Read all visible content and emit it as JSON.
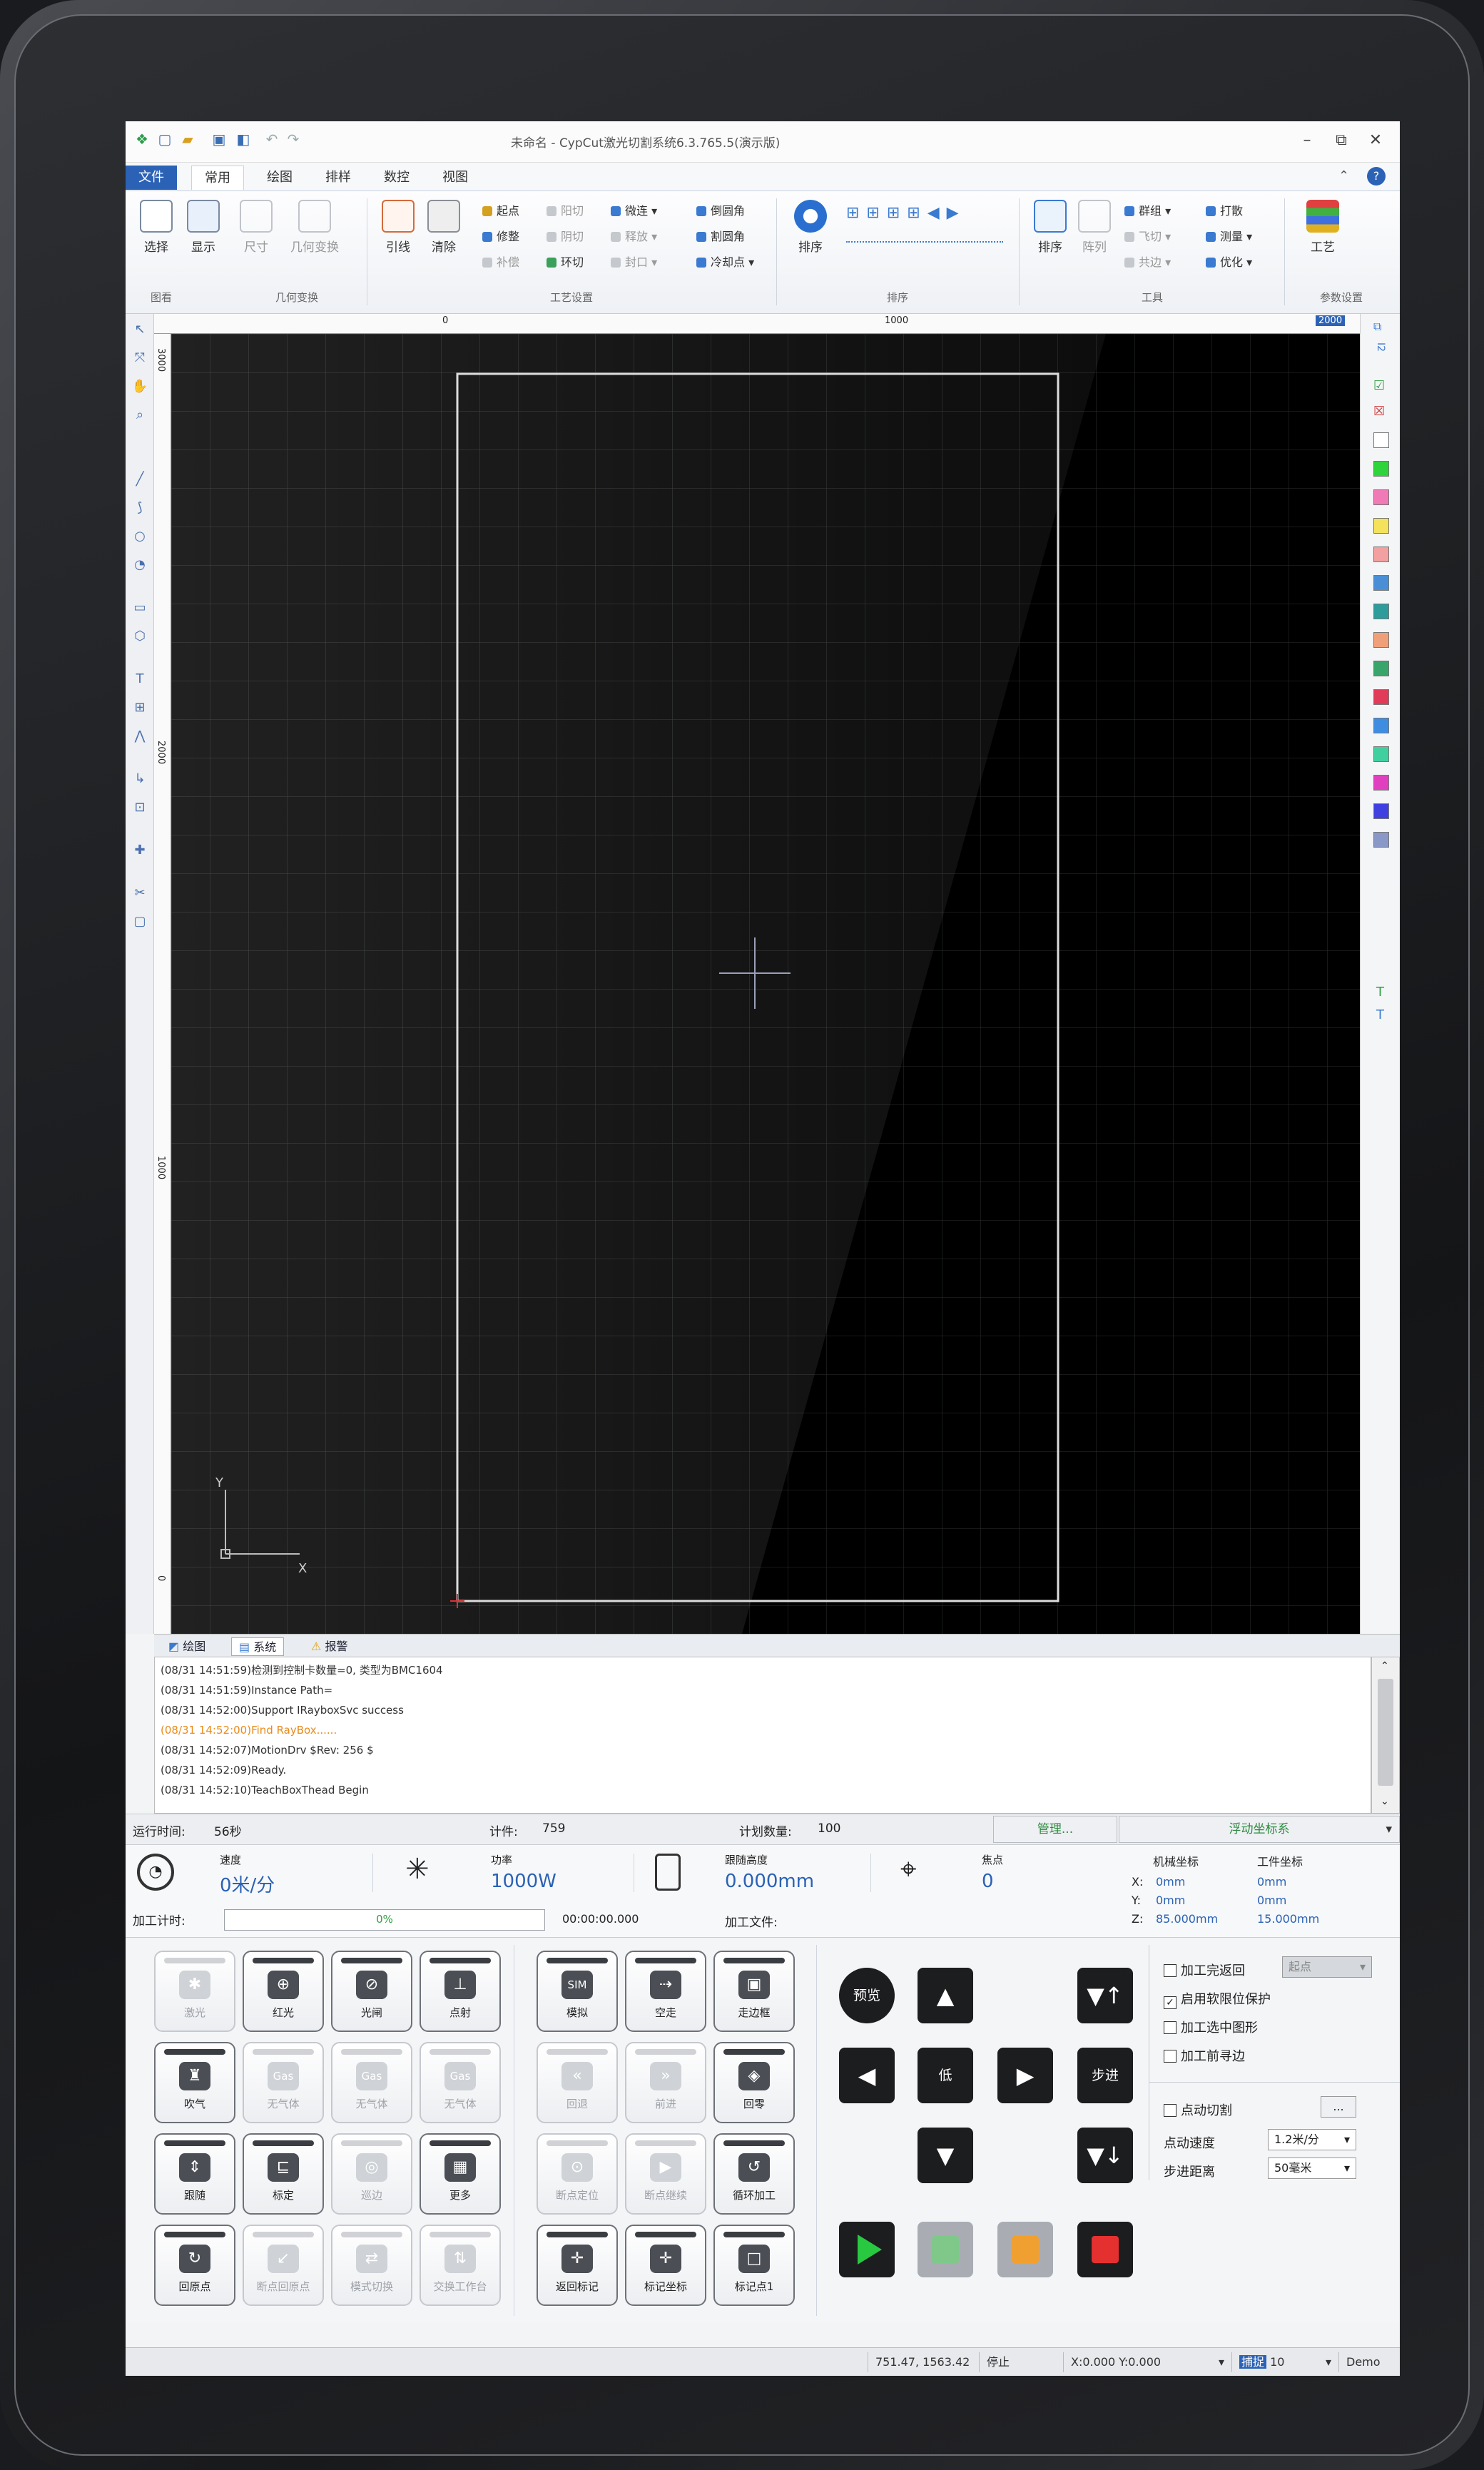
{
  "window": {
    "title": "未命名 - CypCut激光切割系统6.3.765.5(演示版)",
    "quick_access": [
      "logo-icon",
      "new-icon",
      "open-icon",
      "save-icon",
      "settings-icon",
      "undo-icon",
      "redo-icon"
    ],
    "controls": [
      "minimize-icon",
      "restore-icon",
      "close-icon"
    ]
  },
  "menu": {
    "tabs": [
      "文件",
      "常用",
      "绘图",
      "排样",
      "数控",
      "视图"
    ],
    "active": "常用",
    "right_icons": [
      "chevron-up-icon",
      "help-icon"
    ]
  },
  "ribbon": {
    "select": "选择",
    "display": "显示",
    "size": "尺寸",
    "geometry": "几何变换",
    "lead": "引线",
    "clear": "清除",
    "small_col1": [
      "起点",
      "修整",
      "补偿"
    ],
    "small_col2": [
      "阳切",
      "阴切",
      "环切"
    ],
    "small_col3": [
      "微连",
      "释放",
      "封口"
    ],
    "small_col4": [
      "倒圆角",
      "割圆角",
      "冷却点"
    ],
    "sort": "排序",
    "sort_buttons": [
      "排序",
      "阵列"
    ],
    "tools_col": [
      "群组",
      "飞切",
      "共边"
    ],
    "tools_col2": [
      "打散",
      "测量",
      "优化"
    ],
    "process": "工艺",
    "groups": {
      "view": "图看",
      "geometry": "几何变换",
      "process_set": "工艺设置",
      "sort": "排序",
      "tools": "工具",
      "params": "参数设置"
    }
  },
  "ruler": {
    "top": [
      "0",
      "1000",
      "2000"
    ],
    "left": [
      "3000",
      "2000",
      "1000",
      "0"
    ]
  },
  "canvas": {
    "axis_y": "Y",
    "axis_x": "X"
  },
  "palette_colors": [
    "#ffffff",
    "#2fd33b",
    "#f07ab6",
    "#f4e25c",
    "#f2a0a0",
    "#4a8fd6",
    "#2f9c9c",
    "#f0a078",
    "#3aa56a",
    "#e03c5a",
    "#3f8de0",
    "#40d0a0",
    "#e040c0",
    "#4040e0",
    "#8a98c8"
  ],
  "log": {
    "tabs": [
      "绘图",
      "系统",
      "报警"
    ],
    "lines": [
      {
        "text": "(08/31 14:51:59)检测到控制卡数量=0, 类型为BMC1604",
        "color": "#333333"
      },
      {
        "text": "(08/31 14:51:59)Instance Path=",
        "color": "#333333"
      },
      {
        "text": "(08/31 14:52:00)Support IRayboxSvc success",
        "color": "#333333"
      },
      {
        "text": "(08/31 14:52:00)Find RayBox......",
        "color": "#e88a1a"
      },
      {
        "text": "(08/31 14:52:07)MotionDrv $Rev: 256 $",
        "color": "#333333"
      },
      {
        "text": "(08/31 14:52:09)Ready.",
        "color": "#333333"
      },
      {
        "text": "(08/31 14:52:10)TeachBoxThead Begin",
        "color": "#333333"
      }
    ]
  },
  "info": {
    "run_time_label": "运行时间:",
    "run_time": "56秒",
    "count_label": "计件:",
    "count": "759",
    "plan_label": "计划数量:",
    "plan": "100",
    "manage": "管理...",
    "float_coord": "浮动坐标系",
    "speed_label": "速度",
    "speed": "0米/分",
    "power_label": "功率",
    "power": "1000W",
    "follow_label": "跟随高度",
    "follow": "0.000mm",
    "focus_label": "焦点",
    "focus": "0",
    "machine_coord": "机械坐标",
    "work_coord": "工件坐标",
    "coords": [
      {
        "axis": "X:",
        "machine": "0mm",
        "work": "0mm"
      },
      {
        "axis": "Y:",
        "machine": "0mm",
        "work": "0mm"
      },
      {
        "axis": "Z:",
        "machine": "85.000mm",
        "work": "15.000mm"
      }
    ],
    "timer_label": "加工计时:",
    "progress_text": "0%",
    "progress": 0,
    "elapsed": "00:00:00.000",
    "file_label": "加工文件:"
  },
  "panel": {
    "left": [
      [
        {
          "label": "激光",
          "glyph": "✱",
          "enabled": false
        },
        {
          "label": "红光",
          "glyph": "⊕",
          "enabled": true
        },
        {
          "label": "光闸",
          "glyph": "⊘",
          "enabled": true
        },
        {
          "label": "点射",
          "glyph": "⊥",
          "enabled": true
        }
      ],
      [
        {
          "label": "吹气",
          "glyph": "♜",
          "enabled": true
        },
        {
          "label": "无气体",
          "glyph": "Gas",
          "enabled": false
        },
        {
          "label": "无气体",
          "glyph": "Gas",
          "enabled": false
        },
        {
          "label": "无气体",
          "glyph": "Gas",
          "enabled": false
        }
      ],
      [
        {
          "label": "跟随",
          "glyph": "⇕",
          "enabled": true
        },
        {
          "label": "标定",
          "glyph": "⊑",
          "enabled": true
        },
        {
          "label": "巡边",
          "glyph": "◎",
          "enabled": false
        },
        {
          "label": "更多",
          "glyph": "▦",
          "enabled": true
        }
      ],
      [
        {
          "label": "回原点",
          "glyph": "↻",
          "enabled": true
        },
        {
          "label": "断点回原点",
          "glyph": "↙",
          "enabled": false
        },
        {
          "label": "模式切换",
          "glyph": "⇄",
          "enabled": false
        },
        {
          "label": "交换工作台",
          "glyph": "⇅",
          "enabled": false
        }
      ]
    ],
    "mid": [
      [
        {
          "label": "模拟",
          "glyph": "SIM",
          "enabled": true
        },
        {
          "label": "空走",
          "glyph": "⇢",
          "enabled": true
        },
        {
          "label": "走边框",
          "glyph": "▣",
          "enabled": true
        }
      ],
      [
        {
          "label": "回退",
          "glyph": "«",
          "enabled": false
        },
        {
          "label": "前进",
          "glyph": "»",
          "enabled": false
        },
        {
          "label": "回零",
          "glyph": "◈",
          "enabled": true
        }
      ],
      [
        {
          "label": "断点定位",
          "glyph": "⊙",
          "enabled": false
        },
        {
          "label": "断点继续",
          "glyph": "▶",
          "enabled": false
        },
        {
          "label": "循环加工",
          "glyph": "↺",
          "enabled": true
        }
      ],
      [
        {
          "label": "返回标记",
          "glyph": "✛",
          "enabled": true
        },
        {
          "label": "标记坐标",
          "glyph": "✛",
          "enabled": true
        },
        {
          "label": "标记点1",
          "glyph": "□",
          "enabled": true
        }
      ]
    ],
    "jog": {
      "preview": "预览",
      "low": "低",
      "step": "步进"
    },
    "options": [
      "加工完返回",
      "启用软限位保护",
      "加工选中图形",
      "加工前寻边"
    ],
    "options_checked": [
      false,
      true,
      false,
      false
    ],
    "return_select": "起点",
    "jog_cut": "点动切割",
    "more": "...",
    "jog_speed_label": "点动速度",
    "jog_speed": "1.2米/分",
    "step_label": "步进距离",
    "step_value": "50毫米",
    "run_colors": {
      "start": "#28c840",
      "pause": "#f0a030",
      "stop": "#e53030"
    }
  },
  "status": {
    "position": "751.47, 1563.42",
    "state": "停止",
    "offset": "X:0.000 Y:0.000",
    "snap_label": "捕捉",
    "snap": "10",
    "mode": "Demo"
  }
}
